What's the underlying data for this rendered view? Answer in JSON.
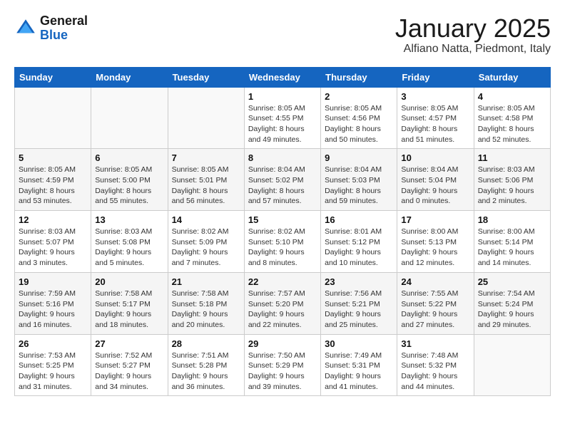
{
  "logo": {
    "line1": "General",
    "line2": "Blue"
  },
  "title": {
    "month": "January 2025",
    "location": "Alfiano Natta, Piedmont, Italy"
  },
  "headers": [
    "Sunday",
    "Monday",
    "Tuesday",
    "Wednesday",
    "Thursday",
    "Friday",
    "Saturday"
  ],
  "weeks": [
    [
      {
        "day": "",
        "info": ""
      },
      {
        "day": "",
        "info": ""
      },
      {
        "day": "",
        "info": ""
      },
      {
        "day": "1",
        "info": "Sunrise: 8:05 AM\nSunset: 4:55 PM\nDaylight: 8 hours\nand 49 minutes."
      },
      {
        "day": "2",
        "info": "Sunrise: 8:05 AM\nSunset: 4:56 PM\nDaylight: 8 hours\nand 50 minutes."
      },
      {
        "day": "3",
        "info": "Sunrise: 8:05 AM\nSunset: 4:57 PM\nDaylight: 8 hours\nand 51 minutes."
      },
      {
        "day": "4",
        "info": "Sunrise: 8:05 AM\nSunset: 4:58 PM\nDaylight: 8 hours\nand 52 minutes."
      }
    ],
    [
      {
        "day": "5",
        "info": "Sunrise: 8:05 AM\nSunset: 4:59 PM\nDaylight: 8 hours\nand 53 minutes."
      },
      {
        "day": "6",
        "info": "Sunrise: 8:05 AM\nSunset: 5:00 PM\nDaylight: 8 hours\nand 55 minutes."
      },
      {
        "day": "7",
        "info": "Sunrise: 8:05 AM\nSunset: 5:01 PM\nDaylight: 8 hours\nand 56 minutes."
      },
      {
        "day": "8",
        "info": "Sunrise: 8:04 AM\nSunset: 5:02 PM\nDaylight: 8 hours\nand 57 minutes."
      },
      {
        "day": "9",
        "info": "Sunrise: 8:04 AM\nSunset: 5:03 PM\nDaylight: 8 hours\nand 59 minutes."
      },
      {
        "day": "10",
        "info": "Sunrise: 8:04 AM\nSunset: 5:04 PM\nDaylight: 9 hours\nand 0 minutes."
      },
      {
        "day": "11",
        "info": "Sunrise: 8:03 AM\nSunset: 5:06 PM\nDaylight: 9 hours\nand 2 minutes."
      }
    ],
    [
      {
        "day": "12",
        "info": "Sunrise: 8:03 AM\nSunset: 5:07 PM\nDaylight: 9 hours\nand 3 minutes."
      },
      {
        "day": "13",
        "info": "Sunrise: 8:03 AM\nSunset: 5:08 PM\nDaylight: 9 hours\nand 5 minutes."
      },
      {
        "day": "14",
        "info": "Sunrise: 8:02 AM\nSunset: 5:09 PM\nDaylight: 9 hours\nand 7 minutes."
      },
      {
        "day": "15",
        "info": "Sunrise: 8:02 AM\nSunset: 5:10 PM\nDaylight: 9 hours\nand 8 minutes."
      },
      {
        "day": "16",
        "info": "Sunrise: 8:01 AM\nSunset: 5:12 PM\nDaylight: 9 hours\nand 10 minutes."
      },
      {
        "day": "17",
        "info": "Sunrise: 8:00 AM\nSunset: 5:13 PM\nDaylight: 9 hours\nand 12 minutes."
      },
      {
        "day": "18",
        "info": "Sunrise: 8:00 AM\nSunset: 5:14 PM\nDaylight: 9 hours\nand 14 minutes."
      }
    ],
    [
      {
        "day": "19",
        "info": "Sunrise: 7:59 AM\nSunset: 5:16 PM\nDaylight: 9 hours\nand 16 minutes."
      },
      {
        "day": "20",
        "info": "Sunrise: 7:58 AM\nSunset: 5:17 PM\nDaylight: 9 hours\nand 18 minutes."
      },
      {
        "day": "21",
        "info": "Sunrise: 7:58 AM\nSunset: 5:18 PM\nDaylight: 9 hours\nand 20 minutes."
      },
      {
        "day": "22",
        "info": "Sunrise: 7:57 AM\nSunset: 5:20 PM\nDaylight: 9 hours\nand 22 minutes."
      },
      {
        "day": "23",
        "info": "Sunrise: 7:56 AM\nSunset: 5:21 PM\nDaylight: 9 hours\nand 25 minutes."
      },
      {
        "day": "24",
        "info": "Sunrise: 7:55 AM\nSunset: 5:22 PM\nDaylight: 9 hours\nand 27 minutes."
      },
      {
        "day": "25",
        "info": "Sunrise: 7:54 AM\nSunset: 5:24 PM\nDaylight: 9 hours\nand 29 minutes."
      }
    ],
    [
      {
        "day": "26",
        "info": "Sunrise: 7:53 AM\nSunset: 5:25 PM\nDaylight: 9 hours\nand 31 minutes."
      },
      {
        "day": "27",
        "info": "Sunrise: 7:52 AM\nSunset: 5:27 PM\nDaylight: 9 hours\nand 34 minutes."
      },
      {
        "day": "28",
        "info": "Sunrise: 7:51 AM\nSunset: 5:28 PM\nDaylight: 9 hours\nand 36 minutes."
      },
      {
        "day": "29",
        "info": "Sunrise: 7:50 AM\nSunset: 5:29 PM\nDaylight: 9 hours\nand 39 minutes."
      },
      {
        "day": "30",
        "info": "Sunrise: 7:49 AM\nSunset: 5:31 PM\nDaylight: 9 hours\nand 41 minutes."
      },
      {
        "day": "31",
        "info": "Sunrise: 7:48 AM\nSunset: 5:32 PM\nDaylight: 9 hours\nand 44 minutes."
      },
      {
        "day": "",
        "info": ""
      }
    ]
  ]
}
